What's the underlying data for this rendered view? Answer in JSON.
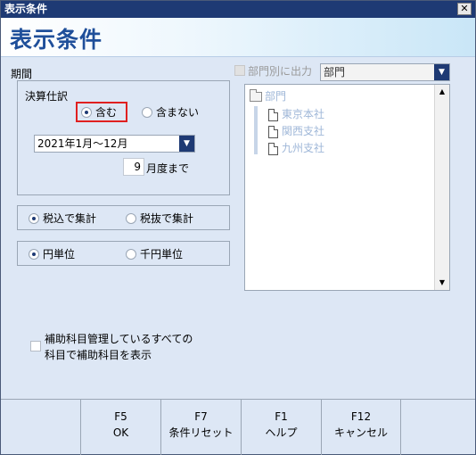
{
  "window": {
    "title": "表示条件",
    "close_symbol": "✕"
  },
  "header": {
    "title": "表示条件"
  },
  "period": {
    "label": "期間",
    "settlement": {
      "label": "決算仕訳",
      "include": "含む",
      "exclude": "含まない",
      "selected": "include"
    },
    "range": {
      "value": "2021年1月～12月"
    },
    "month": {
      "value": "9",
      "suffix": "月度まで"
    }
  },
  "tax": {
    "inclusive": "税込で集計",
    "exclusive": "税抜で集計",
    "selected": "inclusive"
  },
  "unit": {
    "yen": "円単位",
    "thousand_yen": "千円単位",
    "selected": "yen"
  },
  "subsidiary": {
    "label_line1": "補助科目管理しているすべての",
    "label_line2": "科目で補助科目を表示",
    "checked": false
  },
  "dept": {
    "checkbox_label": "部門別に出力",
    "select_value": "部門",
    "tree": {
      "root": "部門",
      "children": [
        "東京本社",
        "関西支社",
        "九州支社"
      ]
    }
  },
  "footer": {
    "keys": [
      {
        "key": "F5",
        "label": "OK"
      },
      {
        "key": "F7",
        "label": "条件リセット"
      },
      {
        "key": "F1",
        "label": "ヘルプ"
      },
      {
        "key": "F12",
        "label": "キャンセル"
      }
    ]
  },
  "colors": {
    "accent": "#1e3a74",
    "header_title": "#1f4f9a",
    "highlight": "#e02020"
  }
}
